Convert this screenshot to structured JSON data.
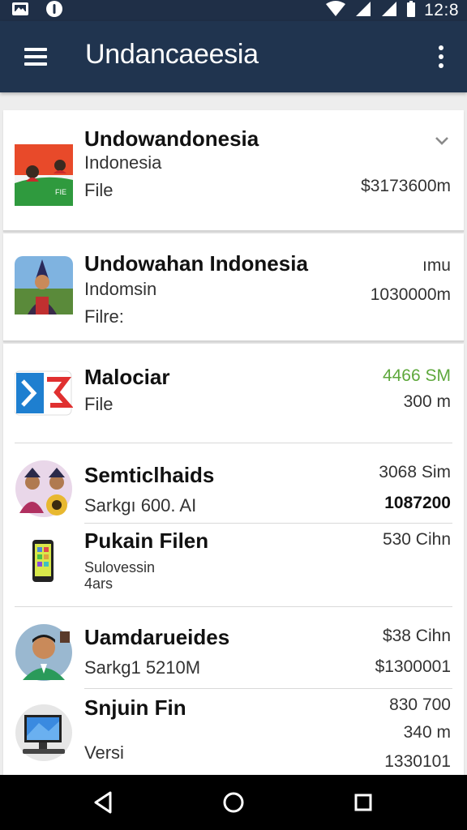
{
  "status": {
    "time": "12:8"
  },
  "appbar": {
    "title": "Undancaeesia"
  },
  "colors": {
    "appbar": "#20344f",
    "statusbar": "#1f2f47",
    "accent_green": "#5ea83c"
  },
  "items": [
    {
      "title": "Undowandonesia",
      "line2": "Indonesia",
      "line3": "File",
      "right1": "$3173600m",
      "icon": "indonesia-flag-thumbnail"
    },
    {
      "title": "Undowahan Indonesia",
      "line2": "Indomsin",
      "line3": "Filre:",
      "right1": "ımu",
      "right2": "1030000m",
      "icon": "person-hat-thumbnail"
    },
    {
      "title": "Malociar",
      "line2": "File",
      "right1": "4466 SM",
      "right2": "300 m",
      "icon": "app-logo-thumbnail"
    },
    {
      "title": "Semticlhaids",
      "line2": "Sarkgı 600. AI",
      "right1": "3068 Sim",
      "right2": "1087200",
      "icon": "two-people-thumbnail"
    },
    {
      "title": "Pukain Filen",
      "line2": "Sulovessin",
      "line3": "4ars",
      "right1": "530 Cihn",
      "icon": "smartphone-thumbnail"
    },
    {
      "title": "Uamdarueides",
      "line2": "Sarkg1 5210M",
      "right1": "$38 Cihn",
      "right2": "$1300001",
      "icon": "man-portrait-thumbnail"
    },
    {
      "title": "Snjuin Fin",
      "line2": "Versi",
      "right1": "830 700",
      "right2": "340 m",
      "right3": "1330101",
      "icon": "desktop-computer-thumbnail"
    }
  ]
}
